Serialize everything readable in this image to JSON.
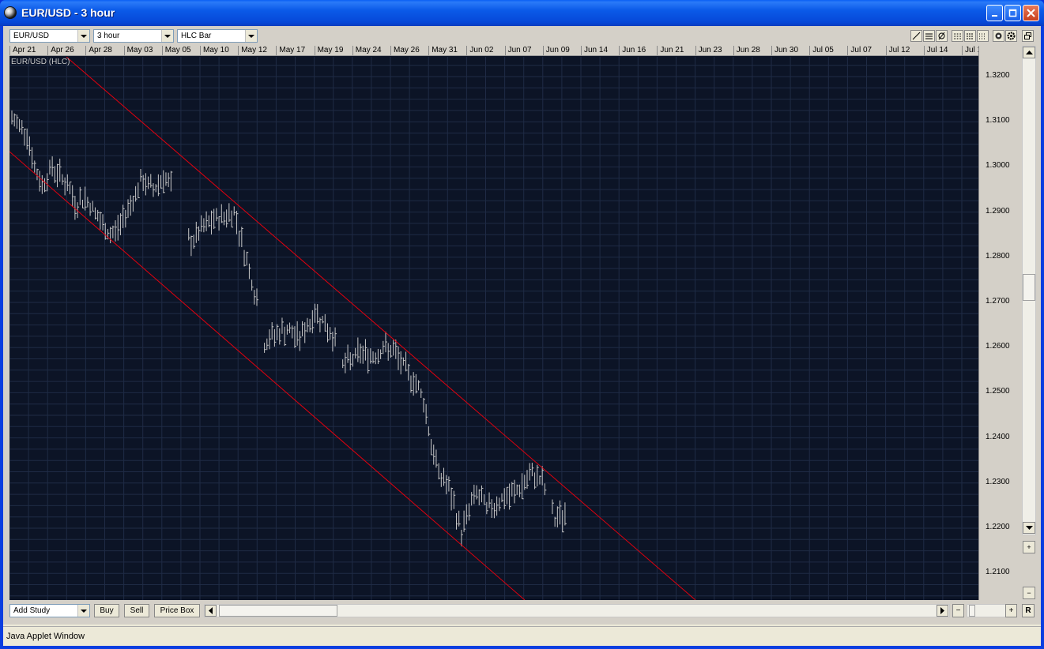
{
  "window": {
    "title": "EUR/USD - 3 hour",
    "status_text": "Java Applet Window"
  },
  "toolbar": {
    "symbol": "EUR/USD",
    "interval": "3 hour",
    "chart_style": "HLC Bar"
  },
  "chart": {
    "series_label": "EUR/USD (HLC)",
    "dates": [
      "Apr 21",
      "Apr 26",
      "Apr 28",
      "May 03",
      "May 05",
      "May 10",
      "May 12",
      "May 17",
      "May 19",
      "May 24",
      "May 26",
      "May 31",
      "Jun 02",
      "Jun 07",
      "Jun 09",
      "Jun 14",
      "Jun 16",
      "Jun 21",
      "Jun 23",
      "Jun 28",
      "Jun 30",
      "Jul 05",
      "Jul 07",
      "Jul 12",
      "Jul 14",
      "Jul 1"
    ],
    "prices": [
      "1.3200",
      "1.3100",
      "1.3000",
      "1.2900",
      "1.2800",
      "1.2700",
      "1.2600",
      "1.2500",
      "1.2400",
      "1.2300",
      "1.2200",
      "1.2100"
    ],
    "channel_color": "#e0000e",
    "bar_color": "#c8c8c8",
    "grid_color": "#1f2b45",
    "background": "#0c1426"
  },
  "chart_data": {
    "type": "hlc_bar",
    "symbol": "EUR/USD",
    "interval": "3 hour",
    "close_path": [
      [
        0,
        1.3105
      ],
      [
        4,
        1.308
      ],
      [
        6,
        1.3
      ],
      [
        8,
        1.296
      ],
      [
        11,
        1.3
      ],
      [
        15,
        1.296
      ],
      [
        17,
        1.292
      ],
      [
        20,
        1.293
      ],
      [
        23,
        1.289
      ],
      [
        25,
        1.286
      ],
      [
        27,
        1.285
      ],
      [
        29,
        1.287
      ],
      [
        32,
        1.292
      ],
      [
        35,
        1.297
      ],
      [
        38,
        1.295
      ],
      [
        41,
        1.298
      ],
      [
        43,
        1.295
      ],
      [
        48,
        1.283
      ],
      [
        51,
        1.286
      ],
      [
        54,
        1.288
      ],
      [
        57,
        1.289
      ],
      [
        60,
        1.29
      ],
      [
        62,
        1.283
      ],
      [
        64,
        1.277
      ],
      [
        66,
        1.27
      ],
      [
        68,
        1.261
      ],
      [
        71,
        1.263
      ],
      [
        74,
        1.264
      ],
      [
        77,
        1.262
      ],
      [
        79,
        1.264
      ],
      [
        82,
        1.268
      ],
      [
        85,
        1.264
      ],
      [
        87,
        1.262
      ],
      [
        89,
        1.256
      ],
      [
        91,
        1.257
      ],
      [
        94,
        1.259
      ],
      [
        97,
        1.258
      ],
      [
        100,
        1.26
      ],
      [
        103,
        1.259
      ],
      [
        106,
        1.255
      ],
      [
        109,
        1.252
      ],
      [
        111,
        1.248
      ],
      [
        113,
        1.238
      ],
      [
        115,
        1.232
      ],
      [
        117,
        1.23
      ],
      [
        119,
        1.225
      ],
      [
        121,
        1.219
      ],
      [
        123,
        1.224
      ],
      [
        125,
        1.228
      ],
      [
        128,
        1.224
      ],
      [
        131,
        1.226
      ],
      [
        134,
        1.227
      ],
      [
        137,
        1.229
      ],
      [
        139,
        1.231
      ],
      [
        141,
        1.232
      ],
      [
        143,
        1.23
      ],
      [
        146,
        1.222
      ],
      [
        149,
        1.223
      ]
    ]
  },
  "bottom": {
    "add_study": "Add Study",
    "buy": "Buy",
    "sell": "Sell",
    "price_box": "Price Box",
    "reset": "R",
    "zoom_out": "−",
    "zoom_in": "+"
  }
}
